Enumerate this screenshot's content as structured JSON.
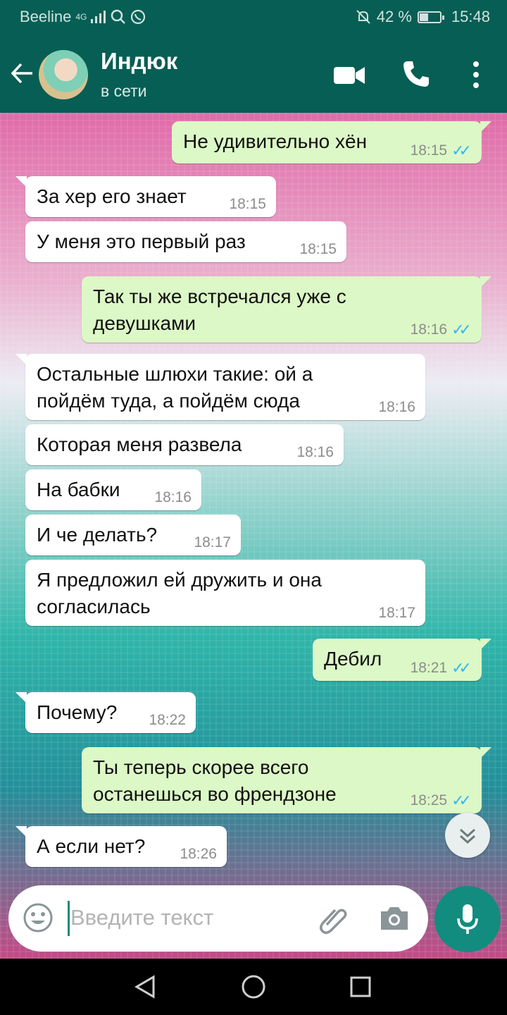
{
  "status": {
    "carrier": "Beeline",
    "network": "4G",
    "battery": "42 %",
    "time": "15:48"
  },
  "contact": {
    "name": "Индюк",
    "status": "в сети"
  },
  "messages": [
    {
      "dir": "out",
      "text": "Не удивительно хён",
      "time": "18:15",
      "read": true
    },
    {
      "dir": "in",
      "text": "За хер его знает",
      "time": "18:15"
    },
    {
      "dir": "in",
      "text": "У меня это первый раз",
      "time": "18:15"
    },
    {
      "dir": "out",
      "text": "Так ты же встречался уже с девушками",
      "time": "18:16",
      "read": true
    },
    {
      "dir": "in",
      "text": "Остальные шлюхи такие: ой а пойдём туда, а пойдём сюда",
      "time": "18:16"
    },
    {
      "dir": "in",
      "text": "Которая меня развела",
      "time": "18:16"
    },
    {
      "dir": "in",
      "text": "На бабки",
      "time": "18:16"
    },
    {
      "dir": "in",
      "text": "И че делать?",
      "time": "18:17"
    },
    {
      "dir": "in",
      "text": "Я предложил ей дружить и она согласилась",
      "time": "18:17"
    },
    {
      "dir": "out",
      "text": "Дебил",
      "time": "18:21",
      "read": true
    },
    {
      "dir": "in",
      "text": "Почему?",
      "time": "18:22"
    },
    {
      "dir": "out",
      "text": "Ты теперь скорее всего останешься во френдзоне",
      "time": "18:25",
      "read": true
    },
    {
      "dir": "in",
      "text": "А если нет?",
      "time": "18:26"
    }
  ],
  "composer": {
    "placeholder": "Введите текст"
  },
  "icons": [
    "back-arrow-icon",
    "video-call-icon",
    "phone-icon",
    "more-vert-icon",
    "emoji-icon",
    "attach-icon",
    "camera-icon",
    "mic-icon",
    "scroll-down-icon",
    "nav-back-icon",
    "nav-home-icon",
    "nav-recents-icon"
  ],
  "colors": {
    "header": "#075e54",
    "outgoing_bubble": "#dcf8c6",
    "incoming_bubble": "#ffffff",
    "accent": "#128c7e",
    "read_ticks": "#34b7f1"
  }
}
